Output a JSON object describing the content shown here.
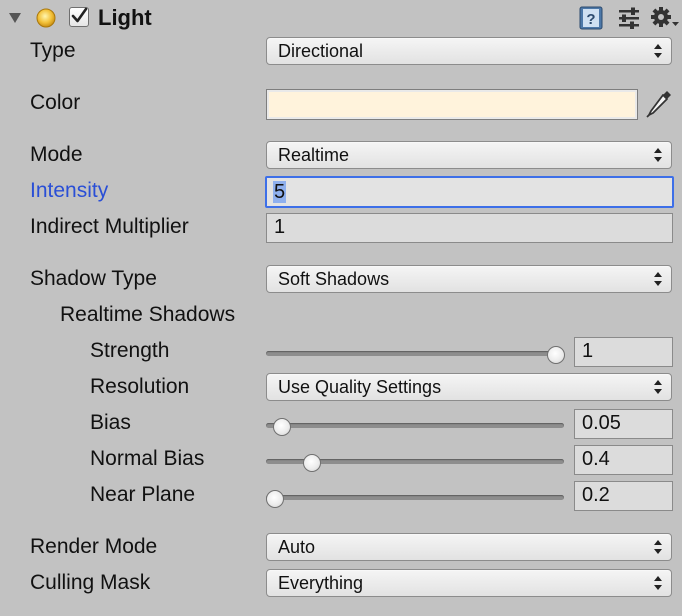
{
  "header": {
    "title": "Light",
    "foldout_icon": "triangle-down-icon",
    "light_icon": "light-bulb-icon",
    "enabled": true,
    "help_icon": "help-book-icon",
    "preset_icon": "preset-sliders-icon",
    "settings_icon": "gear-icon"
  },
  "fields": {
    "type": {
      "label": "Type",
      "value": "Directional"
    },
    "color": {
      "label": "Color",
      "swatch": "#fff3dc",
      "picker_icon": "eyedropper-icon"
    },
    "mode": {
      "label": "Mode",
      "value": "Realtime"
    },
    "intensity": {
      "label": "Intensity",
      "value": "5"
    },
    "indirect_multiplier": {
      "label": "Indirect Multiplier",
      "value": "1"
    },
    "shadow_type": {
      "label": "Shadow Type",
      "value": "Soft Shadows"
    },
    "realtime_shadows": {
      "label": "Realtime Shadows"
    },
    "strength": {
      "label": "Strength",
      "value": "1",
      "level": 1.0
    },
    "resolution": {
      "label": "Resolution",
      "value": "Use Quality Settings"
    },
    "bias": {
      "label": "Bias",
      "value": "0.05",
      "level": 0.025
    },
    "normal_bias": {
      "label": "Normal Bias",
      "value": "0.4",
      "level": 0.133
    },
    "near_plane": {
      "label": "Near Plane",
      "value": "0.2",
      "level": 0.0
    },
    "render_mode": {
      "label": "Render Mode",
      "value": "Auto"
    },
    "culling_mask": {
      "label": "Culling Mask",
      "value": "Everything"
    }
  },
  "colors": {
    "panel_bg": "#c2c2c2",
    "focus_label": "#2a4fd6",
    "focus_border": "#3d6fe8",
    "selection": "#8fb0ee"
  }
}
